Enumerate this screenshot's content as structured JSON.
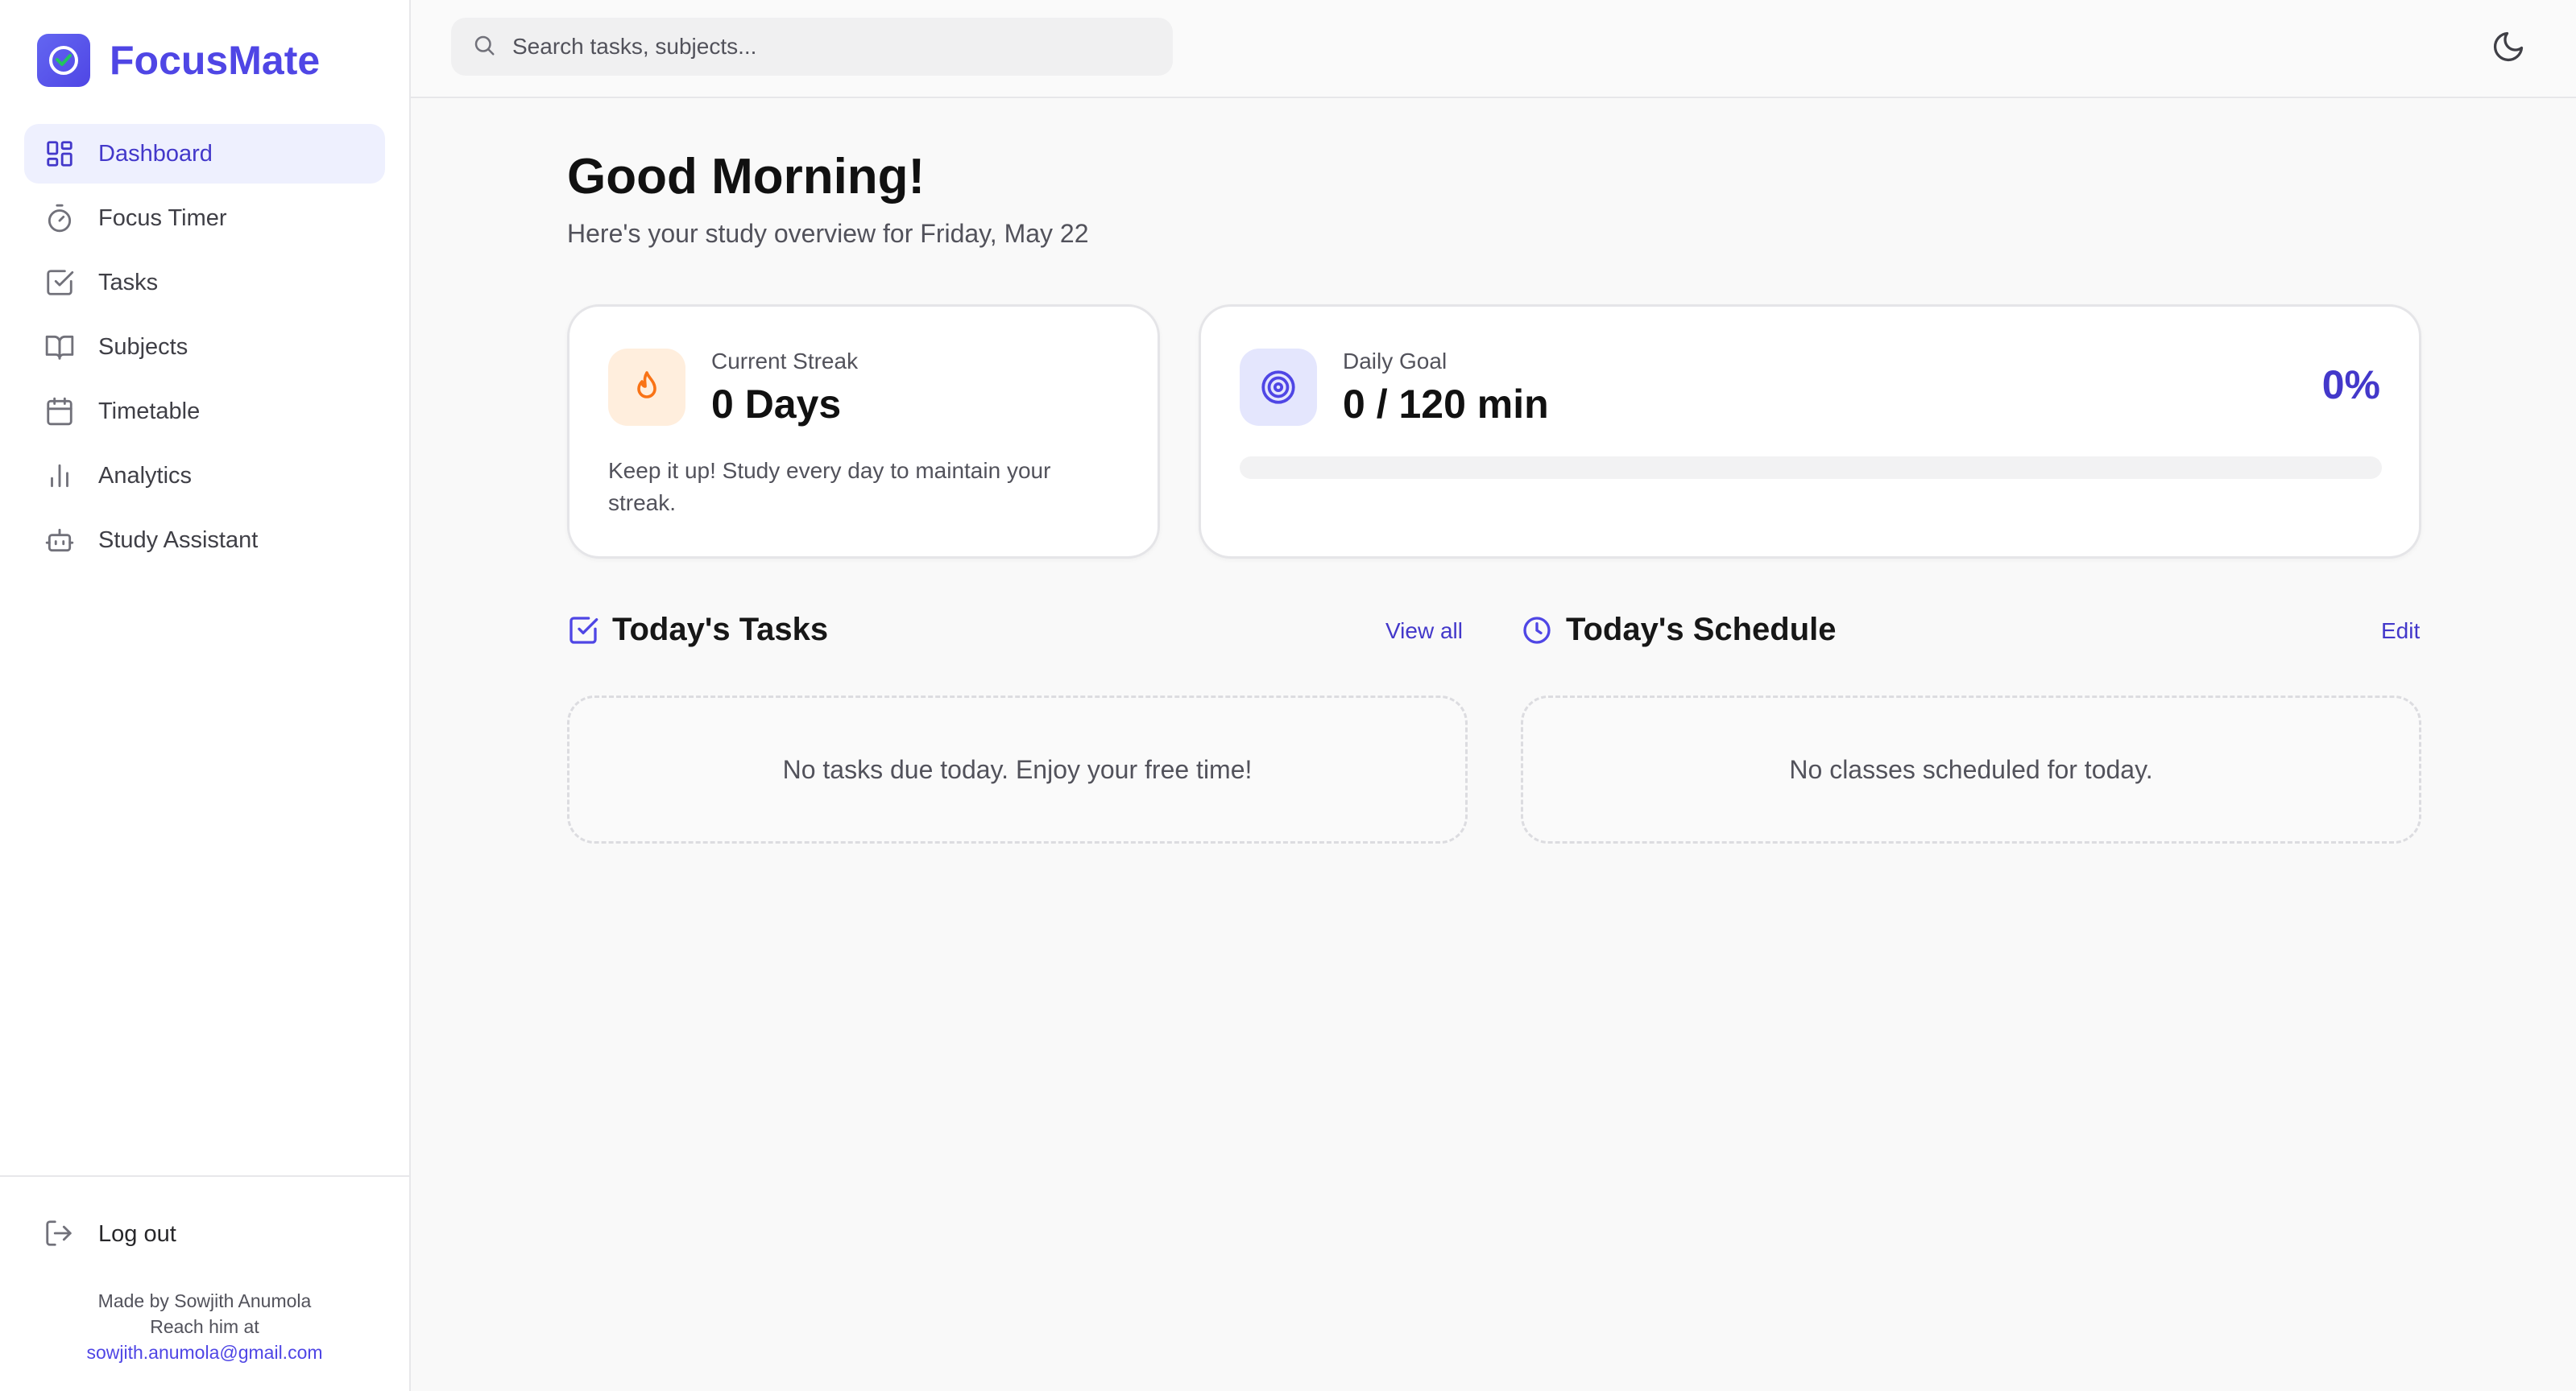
{
  "app": {
    "name": "FocusMate"
  },
  "sidebar": {
    "items": [
      {
        "label": "Dashboard",
        "icon": "dashboard-icon",
        "active": true
      },
      {
        "label": "Focus Timer",
        "icon": "timer-icon"
      },
      {
        "label": "Tasks",
        "icon": "check-square-icon"
      },
      {
        "label": "Subjects",
        "icon": "book-icon"
      },
      {
        "label": "Timetable",
        "icon": "calendar-icon"
      },
      {
        "label": "Analytics",
        "icon": "bar-chart-icon"
      },
      {
        "label": "Study Assistant",
        "icon": "robot-icon"
      }
    ],
    "logout_label": "Log out",
    "credits": {
      "line1": "Made by Sowjith Anumola",
      "line2": "Reach him at",
      "email": "sowjith.anumola@gmail.com"
    }
  },
  "search": {
    "placeholder": "Search tasks, subjects..."
  },
  "main": {
    "greeting": "Good Morning!",
    "subtitle": "Here's your study overview for Friday, May 22",
    "streak": {
      "label": "Current Streak",
      "value": "0 Days",
      "note": "Keep it up! Study every day to maintain your streak."
    },
    "goal": {
      "label": "Daily Goal",
      "value": "0 / 120 min",
      "percent_label": "0%",
      "progress": 0
    },
    "tasks": {
      "title": "Today's Tasks",
      "link": "View all",
      "empty": "No tasks due today. Enjoy your free time!"
    },
    "schedule": {
      "title": "Today's Schedule",
      "link": "Edit",
      "empty": "No classes scheduled for today."
    }
  },
  "colors": {
    "accent": "#4f46e5",
    "accent_dark": "#4338ca",
    "streak_orange": "#f97316",
    "active_bg": "#eef0fe"
  }
}
